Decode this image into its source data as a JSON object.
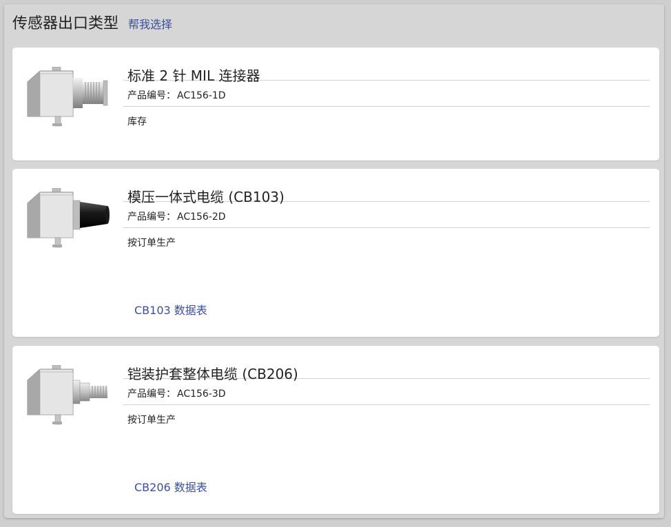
{
  "header": {
    "title": "传感器出口类型",
    "help_link": "帮我选择"
  },
  "products": [
    {
      "title": "标准 2 针 MIL 连接器",
      "part_label": "产品编号：",
      "part_number": "AC156-1D",
      "status": "库存",
      "thumbnail_icon": "sensor-mil-connector-icon"
    },
    {
      "title": "模压一体式电缆 (CB103)",
      "part_label": "产品编号：",
      "part_number": "AC156-2D",
      "status": "按订单生产",
      "datasheet_link": "CB103 数据表",
      "thumbnail_icon": "sensor-molded-cable-icon"
    },
    {
      "title": "铠装护套整体电缆 (CB206)",
      "part_label": "产品编号：",
      "part_number": "AC156-3D",
      "status": "按订单生产",
      "datasheet_link": "CB206 数据表",
      "thumbnail_icon": "sensor-armored-cable-icon"
    }
  ],
  "colors": {
    "link": "#3a4ea0",
    "panel_bg": "#d6d6d6",
    "card_bg": "#ffffff"
  }
}
